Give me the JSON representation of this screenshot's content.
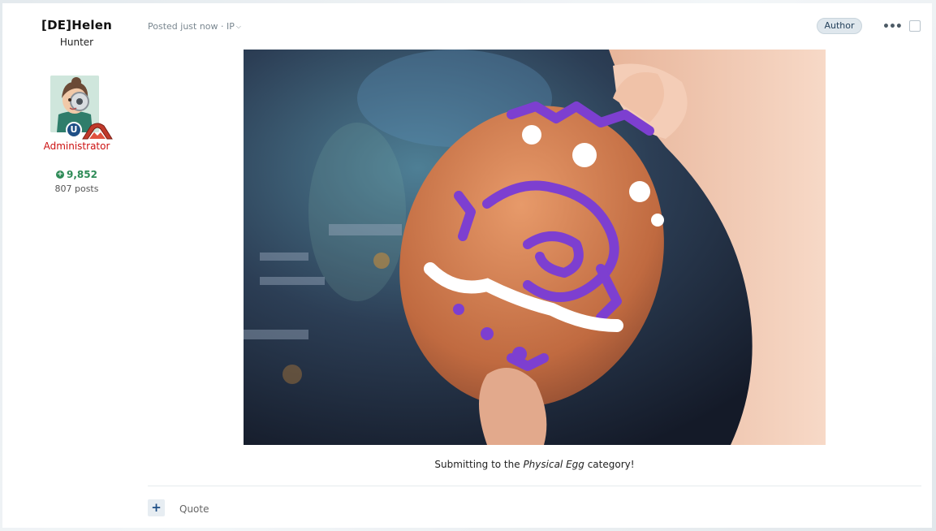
{
  "author": {
    "name": "[DE]Helen",
    "title": "Hunter",
    "role": "Administrator",
    "reputation": "9,852",
    "posts": "807 posts",
    "role_color": "#cc1111",
    "reputation_color": "#2e8b57"
  },
  "post": {
    "meta": "Posted just now · IP",
    "author_badge": "Author",
    "caption_before": "Submitting to the ",
    "caption_emphasis": "Physical Egg",
    "caption_after": " category!"
  },
  "actions": {
    "quote_label": "Quote",
    "plus_icon": "plus-icon",
    "menu_icon": "ellipsis-icon"
  }
}
